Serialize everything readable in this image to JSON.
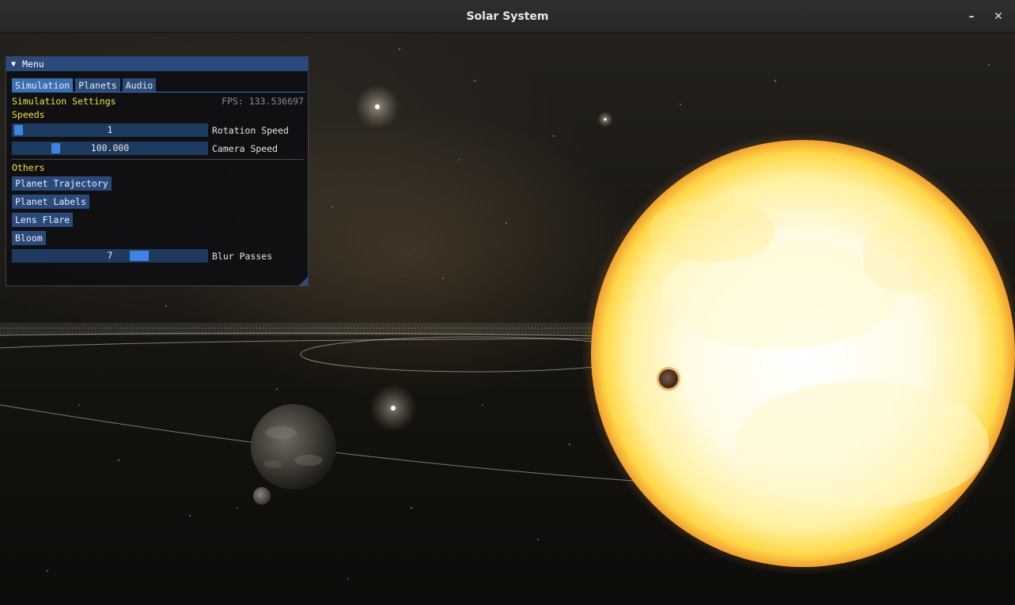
{
  "window": {
    "title": "Solar System"
  },
  "menu": {
    "title": "Menu",
    "tabs": [
      "Simulation",
      "Planets",
      "Audio"
    ],
    "active_tab": "Simulation",
    "section_title": "Simulation Settings",
    "fps_label": "FPS: 133.536697",
    "speeds_heading": "Speeds",
    "rotation_speed": {
      "label": "Rotation Speed",
      "value": "1"
    },
    "camera_speed": {
      "label": "Camera Speed",
      "value": "100.000"
    },
    "others_heading": "Others",
    "buttons": [
      "Planet Trajectory",
      "Planet Labels",
      "Lens Flare",
      "Bloom"
    ],
    "blur_passes": {
      "label": "Blur Passes",
      "value": "7"
    }
  },
  "colors": {
    "panel_bg": "#0f0f12",
    "header": "#294a7a",
    "accent": "#3d85e0",
    "heading_yellow": "#f1e24a",
    "sun": "#fff6c8"
  }
}
